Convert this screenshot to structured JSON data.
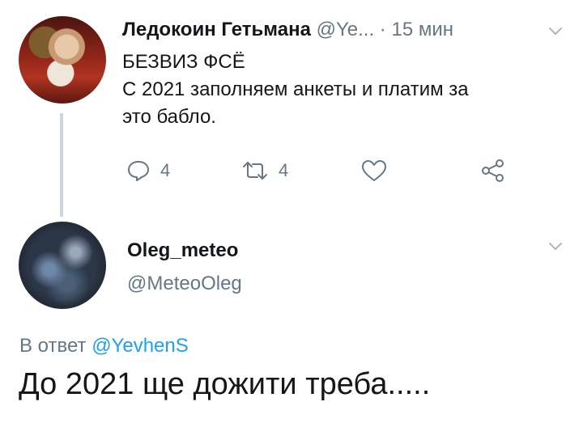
{
  "tweet": {
    "author_name": "Ледокоин Гетьмана",
    "author_handle": "@Ye...",
    "separator": "·",
    "time": "15 мин",
    "text_lines": [
      "БЕЗВИЗ ФСЁ",
      "С 2021 заполняем анкеты и платим за",
      "это бабло."
    ],
    "replies": "4",
    "retweets": "4"
  },
  "reply": {
    "author_name": "Oleg_meteo",
    "author_handle": "@MeteoOleg",
    "reply_to_prefix": "В ответ",
    "reply_to_handle": "@YevhenS",
    "text": "До 2021 ще дожити треба....."
  },
  "icons": {
    "reply": "reply-icon",
    "retweet": "retweet-icon",
    "like": "heart-icon",
    "share": "share-icon",
    "menu": "chevron-down-icon"
  },
  "colors": {
    "text": "#14171a",
    "muted": "#657786",
    "link": "#1da1f2",
    "thread_line": "#ccd6dd"
  }
}
